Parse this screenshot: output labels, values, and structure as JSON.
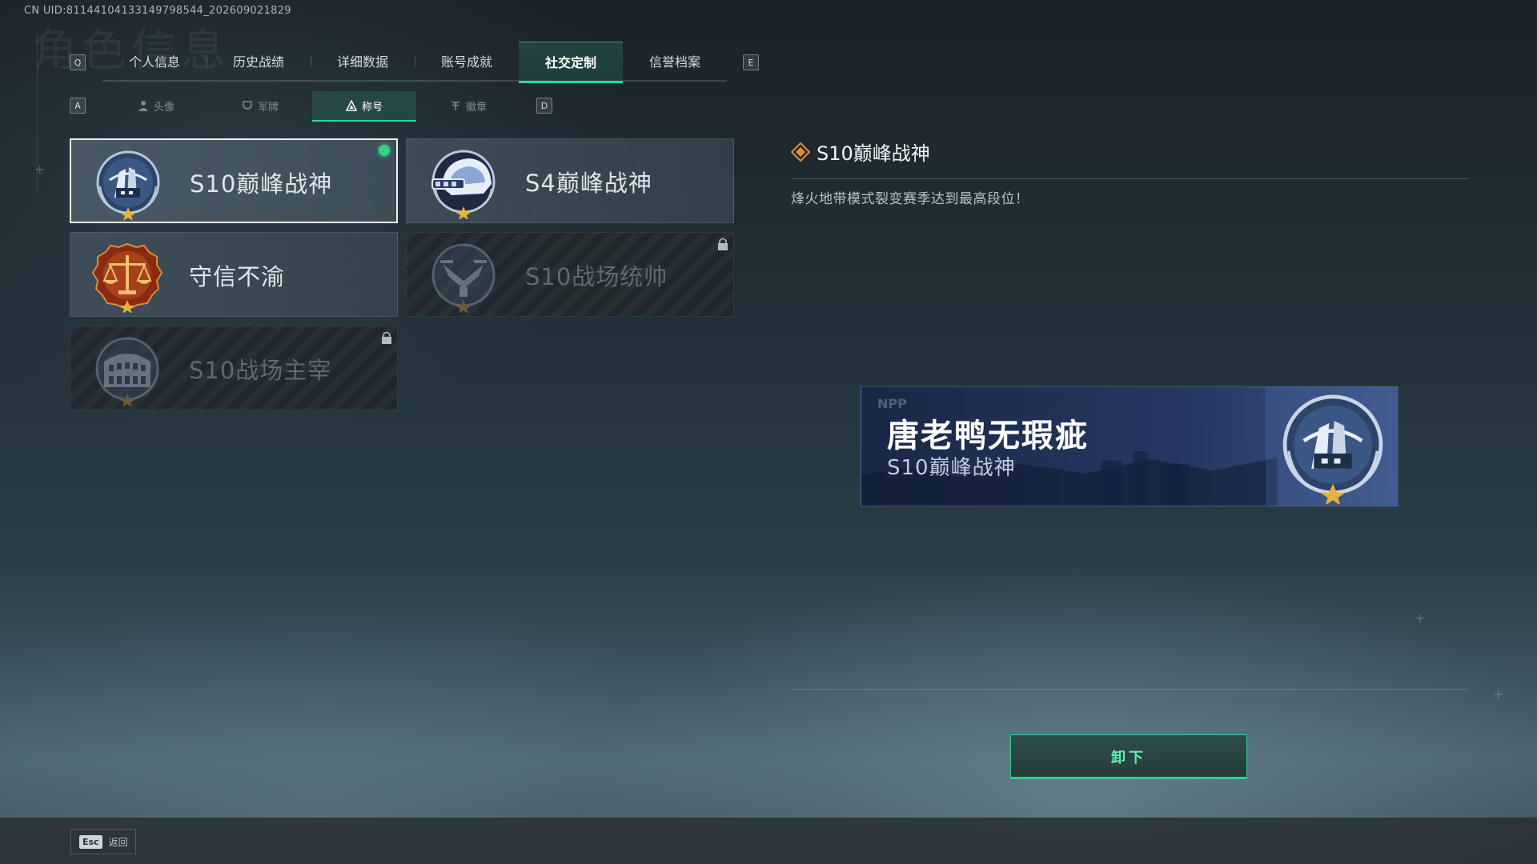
{
  "uid": "CN UID:81144104133149798544_202609021829",
  "main_tabs": {
    "prev_key": "Q",
    "next_key": "E",
    "items": [
      "个人信息",
      "历史战绩",
      "详细数据",
      "账号成就",
      "社交定制",
      "信誉档案"
    ],
    "active_index": 4
  },
  "sub_tabs": {
    "prev_key": "A",
    "next_key": "D",
    "items": [
      {
        "label": "头像",
        "icon": "person-icon"
      },
      {
        "label": "军牌",
        "icon": "shield-icon"
      },
      {
        "label": "称号",
        "icon": "triangle-icon"
      },
      {
        "label": "徽章",
        "icon": "wings-icon"
      }
    ],
    "active_index": 2
  },
  "titles": [
    {
      "name": "S10巅峰战神",
      "badge": "tower-badge",
      "state": "equipped-selected"
    },
    {
      "name": "S4巅峰战神",
      "badge": "helmet-badge",
      "state": "owned"
    },
    {
      "name": "守信不渝",
      "badge": "scales-badge",
      "state": "owned"
    },
    {
      "name": "S10战场统帅",
      "badge": "aircraft-badge",
      "state": "locked"
    },
    {
      "name": "S10战场主宰",
      "badge": "colosseum-badge",
      "state": "locked"
    }
  ],
  "detail": {
    "title": "S10巅峰战神",
    "description": "烽火地带模式裂变赛季达到最高段位！"
  },
  "nameplate": {
    "player_name": "唐老鸭无瑕疵",
    "title": "S10巅峰战神"
  },
  "unequip_label": "卸下",
  "footer": {
    "esc_key": "Esc",
    "esc_label": "返回"
  },
  "colors": {
    "accent": "#2fd39a",
    "equipped_dot": "#31d486",
    "selected_border": "#e8eef1",
    "star": "#e9b13a"
  }
}
